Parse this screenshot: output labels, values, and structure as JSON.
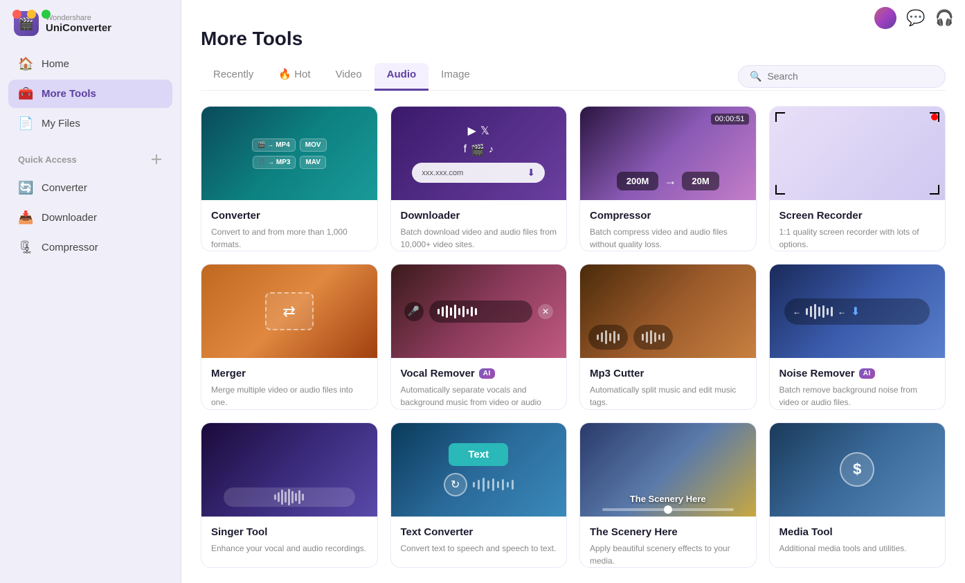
{
  "window": {
    "title": "Wondershare UniConverter",
    "brand": "Wondershare",
    "app": "UniConverter"
  },
  "sidebar": {
    "nav_items": [
      {
        "id": "home",
        "label": "Home",
        "icon": "🏠",
        "active": false
      },
      {
        "id": "more-tools",
        "label": "More Tools",
        "icon": "🧰",
        "active": true
      },
      {
        "id": "my-files",
        "label": "My Files",
        "icon": "📄",
        "active": false
      }
    ],
    "quick_access_label": "Quick Access",
    "quick_items": [
      {
        "id": "converter",
        "label": "Converter",
        "icon": "🔄"
      },
      {
        "id": "downloader",
        "label": "Downloader",
        "icon": "📥"
      },
      {
        "id": "compressor",
        "label": "Compressor",
        "icon": "🗜"
      }
    ]
  },
  "page": {
    "title": "More Tools",
    "tabs": [
      {
        "id": "recently",
        "label": "Recently",
        "active": false
      },
      {
        "id": "hot",
        "label": "Hot",
        "fire": true,
        "active": false
      },
      {
        "id": "video",
        "label": "Video",
        "active": false
      },
      {
        "id": "audio",
        "label": "Audio",
        "active": true
      },
      {
        "id": "image",
        "label": "Image",
        "active": false
      }
    ],
    "search_placeholder": "Search"
  },
  "tools": [
    {
      "id": "converter",
      "title": "Converter",
      "desc": "Convert to and from more than 1,000 formats.",
      "ai": false,
      "thumb_type": "converter"
    },
    {
      "id": "downloader",
      "title": "Downloader",
      "desc": "Batch download video and audio files from 10,000+ video sites.",
      "ai": false,
      "thumb_type": "downloader"
    },
    {
      "id": "compressor",
      "title": "Compressor",
      "desc": "Batch compress video and audio files without quality loss.",
      "ai": false,
      "thumb_type": "compressor"
    },
    {
      "id": "screen-recorder",
      "title": "Screen Recorder",
      "desc": "1:1 quality screen recorder with lots of options.",
      "ai": false,
      "thumb_type": "screen-recorder"
    },
    {
      "id": "merger",
      "title": "Merger",
      "desc": "Merge multiple video or audio files into one.",
      "ai": false,
      "thumb_type": "merger"
    },
    {
      "id": "vocal-remover",
      "title": "Vocal Remover",
      "desc": "Automatically separate vocals and background music from video or audio files.",
      "ai": true,
      "thumb_type": "vocal-remover"
    },
    {
      "id": "mp3-cutter",
      "title": "Mp3 Cutter",
      "desc": "Automatically split music and edit music tags.",
      "ai": false,
      "thumb_type": "mp3-cutter"
    },
    {
      "id": "noise-remover",
      "title": "Noise Remover",
      "desc": "Batch remove background noise from video or audio files.",
      "ai": true,
      "thumb_type": "noise-remover"
    },
    {
      "id": "singer",
      "title": "Singer Tool",
      "desc": "Enhance your vocal and audio recordings.",
      "ai": false,
      "thumb_type": "singer"
    },
    {
      "id": "text-converter",
      "title": "Text Converter",
      "desc": "Convert text to speech and speech to text.",
      "ai": false,
      "thumb_type": "text-converter",
      "text_label": "Text"
    },
    {
      "id": "scenery",
      "title": "The Scenery Here",
      "desc": "Apply beautiful scenery effects to your media.",
      "ai": false,
      "thumb_type": "scenery",
      "scenery_label": "The Scenery Here"
    },
    {
      "id": "currency",
      "title": "Media Tool",
      "desc": "Additional media tools and utilities.",
      "ai": false,
      "thumb_type": "currency"
    }
  ]
}
